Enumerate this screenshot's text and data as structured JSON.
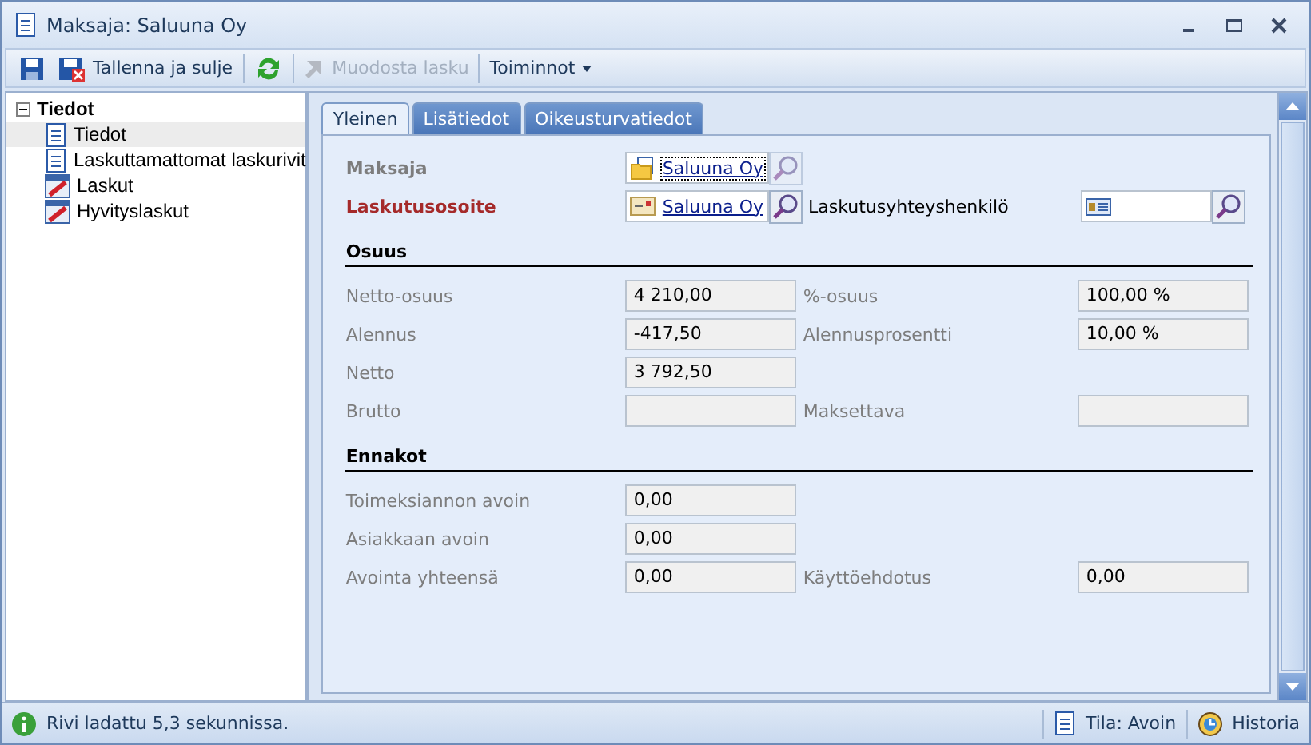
{
  "window": {
    "title": "Maksaja: Saluuna Oy"
  },
  "toolbar": [
    {
      "kind": "save"
    },
    {
      "kind": "save-close",
      "label": "Tallenna ja sulje",
      "disabled": false
    },
    {
      "kind": "refresh"
    },
    {
      "kind": "create",
      "label": "Muodosta lasku",
      "disabled": true
    },
    {
      "kind": "menu",
      "label": "Toiminnot",
      "disabled": false
    }
  ],
  "tree": [
    {
      "label": "Tiedot",
      "expanded": true,
      "children": [
        {
          "label": "Tiedot",
          "kind": "document",
          "selected": true
        },
        {
          "label": "Laskuttamattomat laskurivit",
          "kind": "document",
          "selected": false
        },
        {
          "label": "Laskut",
          "kind": "invoice",
          "selected": false
        },
        {
          "label": "Hyvityslaskut",
          "kind": "invoice",
          "selected": false
        }
      ]
    }
  ],
  "tabs": [
    {
      "label": "Yleinen",
      "selected": true
    },
    {
      "label": "Lisätiedot",
      "selected": false
    },
    {
      "label": "Oikeusturvatiedot",
      "selected": false
    }
  ],
  "links": [
    {
      "label": "Maksaja",
      "required": false,
      "kind": "folder",
      "value": "Saluuna Oy",
      "search_enabled": false,
      "focused": true
    },
    {
      "label": "Laskutusosoite",
      "required": true,
      "kind": "address",
      "value": "Saluuna Oy",
      "search_enabled": true,
      "focused": false,
      "extra_label": "Laskutusyhteyshenkilö"
    }
  ],
  "sections": [
    {
      "title": "Osuus",
      "rows": [
        [
          {
            "label": "Netto-osuus",
            "value": "4 210,00"
          },
          {
            "label": "%-osuus",
            "value": "100,00 %"
          }
        ],
        [
          {
            "label": "Alennus",
            "value": "-417,50"
          },
          {
            "label": "Alennusprosentti",
            "value": "10,00 %"
          }
        ],
        [
          {
            "label": "Netto",
            "value": "3 792,50"
          }
        ],
        [
          {
            "label": "Brutto"
          },
          {
            "label": "Maksettava"
          }
        ]
      ]
    },
    {
      "title": "Ennakot",
      "rows": [
        [
          {
            "label": "Toimeksiannon avoin",
            "value": "0,00"
          }
        ],
        [
          {
            "label": "Asiakkaan avoin",
            "value": "0,00"
          }
        ],
        [
          {
            "label": "Avointa yhteensä",
            "value": "0,00"
          },
          {
            "label": "Käyttöehdotus",
            "value": "0,00"
          }
        ]
      ]
    }
  ],
  "status_bar": {
    "message": "Rivi ladattu 5,3 sekunnissa.",
    "state": "Tila: Avoin",
    "history": "Historia"
  }
}
